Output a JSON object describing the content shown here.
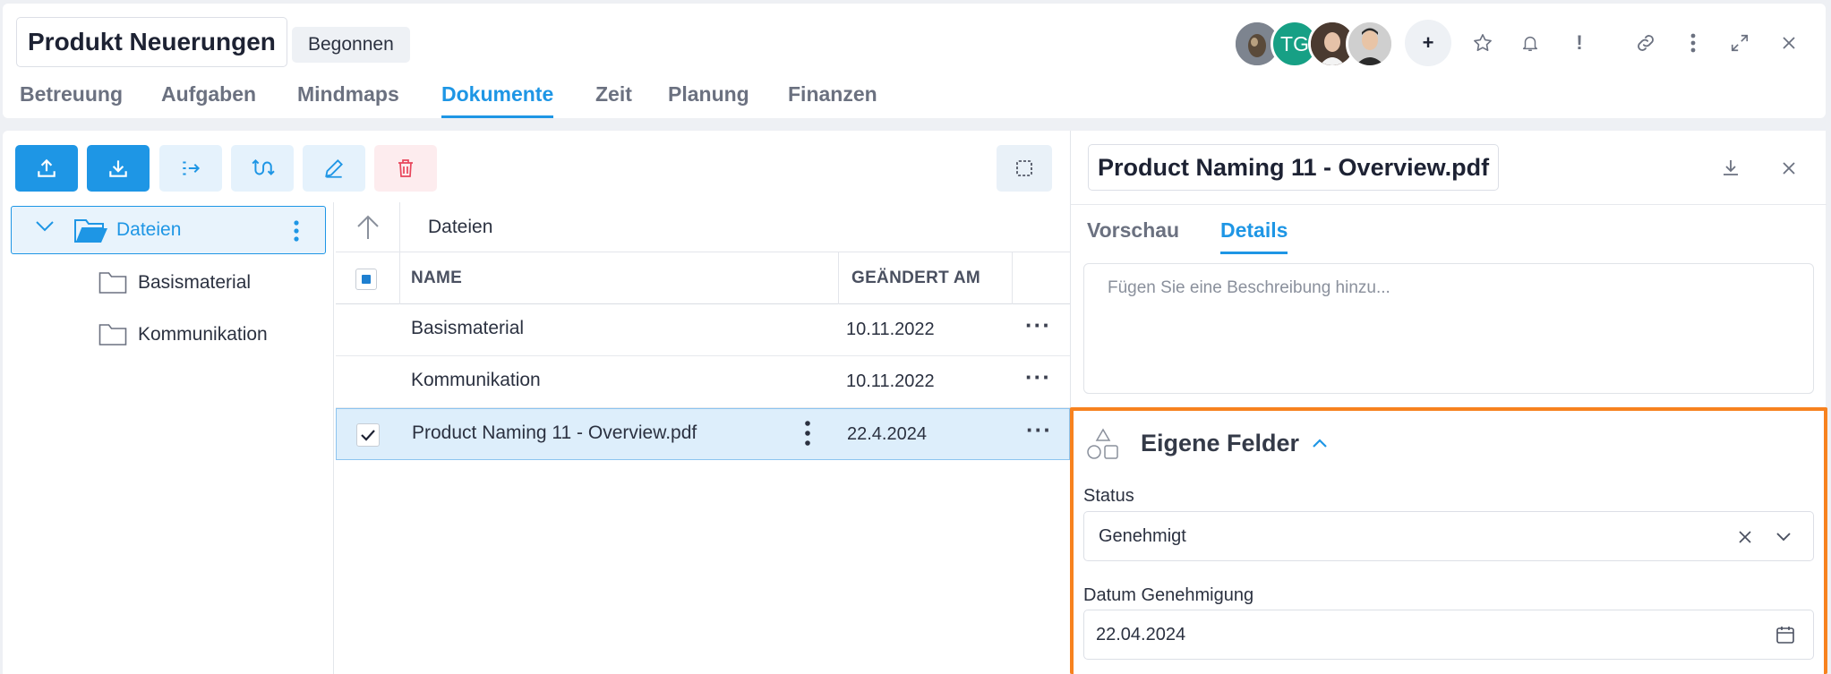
{
  "header": {
    "project_title": "Produkt Neuerungen",
    "status": "Begonnen",
    "tabs": [
      "Betreuung",
      "Aufgaben",
      "Mindmaps",
      "Dokumente",
      "Zeit",
      "Planung",
      "Finanzen"
    ],
    "active_tab": "Dokumente",
    "avatar_initials": "TG",
    "plus_label": "+",
    "alert_label": "!"
  },
  "toolbar": {
    "icons": [
      "upload-icon",
      "download-icon",
      "move-icon",
      "workflow-icon",
      "edit-icon",
      "delete-icon",
      "select-all-icon"
    ]
  },
  "tree": {
    "root": "Dateien",
    "children": [
      "Basismaterial",
      "Kommunikation"
    ]
  },
  "grid": {
    "breadcrumb": "Dateien",
    "columns": {
      "name": "NAME",
      "changed": "GEÄNDERT AM"
    },
    "more_label": "···",
    "rows": [
      {
        "name": "Basismaterial",
        "date": "10.11.2022",
        "selected": false
      },
      {
        "name": "Kommunikation",
        "date": "10.11.2022",
        "selected": false
      },
      {
        "name": "Product Naming 11 - Overview.pdf",
        "date": "22.4.2024",
        "selected": true
      }
    ]
  },
  "details": {
    "file_title": "Product Naming 11 - Overview.pdf",
    "tabs": [
      "Vorschau",
      "Details"
    ],
    "active_tab": "Details",
    "description_placeholder": "Fügen Sie eine Beschreibung hinzu...",
    "custom_fields": {
      "heading": "Eigene Felder",
      "status_label": "Status",
      "status_value": "Genehmigt",
      "date_label": "Datum Genehmigung",
      "date_value": "22.04.2024"
    }
  },
  "colors": {
    "accent": "#1e96e5",
    "highlight": "#f7821f",
    "danger": "#e8455b"
  }
}
